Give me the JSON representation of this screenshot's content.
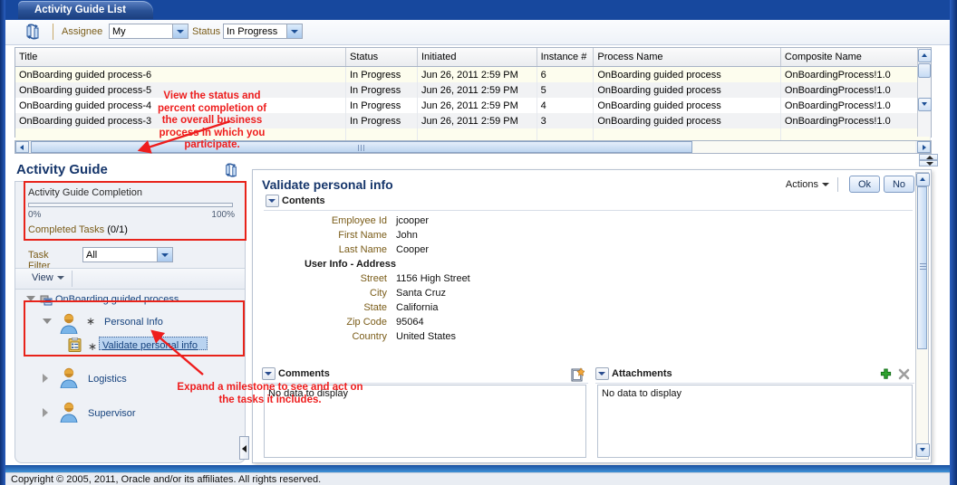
{
  "tab": {
    "label": "Activity Guide List"
  },
  "filter": {
    "refresh_icon": "refresh-icon",
    "assignee_label": "Assignee",
    "assignee_value": "My",
    "status_label": "Status",
    "status_value": "In Progress"
  },
  "grid": {
    "columns": [
      "Title",
      "Status",
      "Initiated",
      "Instance #",
      "Process Name",
      "Composite Name"
    ],
    "rows": [
      {
        "title": "OnBoarding guided process-6",
        "status": "In Progress",
        "initiated": "Jun 26, 2011 2:59 PM",
        "instance": "6",
        "process": "OnBoarding guided process",
        "composite": "OnBoardingProcess!1.0"
      },
      {
        "title": "OnBoarding guided process-5",
        "status": "In Progress",
        "initiated": "Jun 26, 2011 2:59 PM",
        "instance": "5",
        "process": "OnBoarding guided process",
        "composite": "OnBoardingProcess!1.0"
      },
      {
        "title": "OnBoarding guided process-4",
        "status": "In Progress",
        "initiated": "Jun 26, 2011 2:59 PM",
        "instance": "4",
        "process": "OnBoarding guided process",
        "composite": "OnBoardingProcess!1.0"
      },
      {
        "title": "OnBoarding guided process-3",
        "status": "In Progress",
        "initiated": "Jun 26, 2011 2:59 PM",
        "instance": "3",
        "process": "OnBoarding guided process",
        "composite": "OnBoardingProcess!1.0"
      }
    ]
  },
  "activity_guide": {
    "title": "Activity Guide",
    "refresh_icon": "refresh-icon",
    "completion_label": "Activity Guide Completion",
    "progress_percent": 0,
    "progress_min_label": "0%",
    "progress_max_label": "100%",
    "completed_tasks_label": "Completed Tasks",
    "completed_tasks_value": "(0/1)",
    "task_filter_label": "Task Filter",
    "task_filter_value": "All",
    "view_label": "View",
    "tree": {
      "root": "OnBoarding guided process",
      "nodes": [
        {
          "label": "Personal Info",
          "expanded": true,
          "child": "Validate personal info"
        },
        {
          "label": "Logistics",
          "expanded": false
        },
        {
          "label": "Supervisor",
          "expanded": false
        }
      ]
    }
  },
  "detail": {
    "title": "Validate personal info",
    "actions_label": "Actions",
    "ok_label": "Ok",
    "no_label": "No",
    "contents_label": "Contents",
    "fields": [
      {
        "label": "Employee Id",
        "value": "jcooper"
      },
      {
        "label": "First Name",
        "value": "John"
      },
      {
        "label": "Last Name",
        "value": "Cooper"
      }
    ],
    "group_label": "User Info - Address",
    "address_fields": [
      {
        "label": "Street",
        "value": "1156 High Street"
      },
      {
        "label": "City",
        "value": "Santa Cruz"
      },
      {
        "label": "State",
        "value": "California"
      },
      {
        "label": "Zip Code",
        "value": "95064"
      },
      {
        "label": "Country",
        "value": "United States"
      }
    ],
    "comments_label": "Comments",
    "comments_empty": "No data to display",
    "attachments_label": "Attachments",
    "attachments_empty": "No data to display"
  },
  "annotations": {
    "top": "View the status and percent completion of the overall business process in which you participate.",
    "bottom": "Expand a milestone to see and act on the tasks it includes."
  },
  "footer": {
    "copyright": "Copyright © 2005, 2011, Oracle and/or its affiliates. All rights reserved."
  },
  "colors": {
    "brand_blue": "#17489e",
    "annotation_red": "#ee1d1d",
    "label_gold": "#7a5c18"
  }
}
